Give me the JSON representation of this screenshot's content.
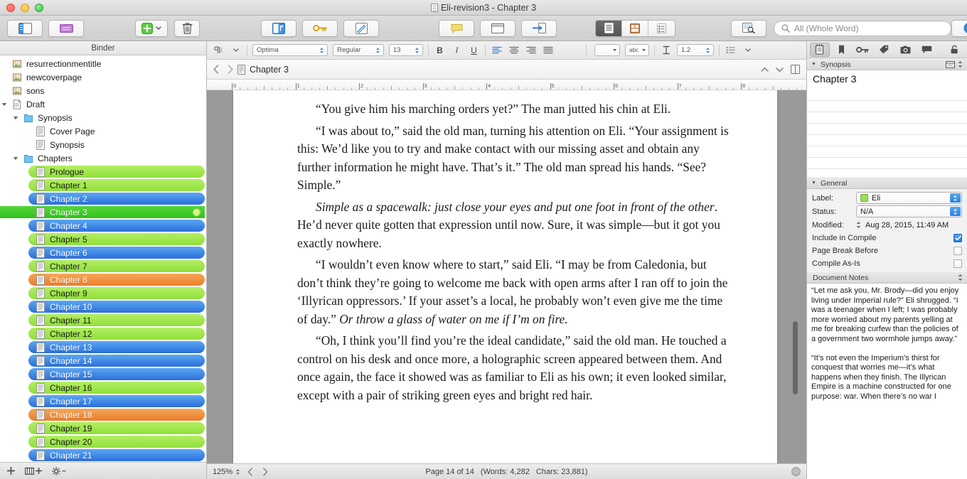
{
  "window": {
    "title": "Eli-revision3 - Chapter 3"
  },
  "toolbar": {
    "binder_label": "binder-toggle",
    "collections_label": "collections-toggle",
    "add_label": "add-new",
    "trash_label": "move-to-trash",
    "compile_label": "compile",
    "keywords_label": "keywords",
    "compose_label": "compose-mode",
    "comment_label": "comment",
    "quickref_label": "quick-reference",
    "split_label": "split-editor",
    "view_document": "document-view",
    "view_corkboard": "corkboard-view",
    "view_outline": "outliner-view",
    "project_search_label": "project-search",
    "search_placeholder": "All (Whole Word)",
    "inspector_label": "toggle-inspector"
  },
  "format_bar": {
    "font": "Optima",
    "style": "Regular",
    "size": "13",
    "bold": "B",
    "italic": "I",
    "underline": "U",
    "line_spacing": "1.2"
  },
  "binder": {
    "header": "Binder",
    "items": [
      {
        "label": "resurrectionmentitle",
        "icon": "image-icon",
        "depth": 0,
        "tint": "none",
        "twisty": "",
        "selected": false
      },
      {
        "label": "newcoverpage",
        "icon": "image-icon",
        "depth": 0,
        "tint": "none",
        "twisty": "",
        "selected": false
      },
      {
        "label": "sons",
        "icon": "image-icon",
        "depth": 0,
        "tint": "none",
        "twisty": "",
        "selected": false
      },
      {
        "label": "Draft",
        "icon": "draft-icon",
        "depth": 0,
        "tint": "none",
        "twisty": "down",
        "selected": false
      },
      {
        "label": "Synopsis",
        "icon": "folder-icon",
        "depth": 1,
        "tint": "none",
        "twisty": "down",
        "selected": false
      },
      {
        "label": "Cover Page",
        "icon": "text-icon",
        "depth": 2,
        "tint": "none",
        "twisty": "",
        "selected": false
      },
      {
        "label": "Synopsis",
        "icon": "text-icon",
        "depth": 2,
        "tint": "none",
        "twisty": "",
        "selected": false
      },
      {
        "label": "Chapters",
        "icon": "folder-icon",
        "depth": 1,
        "tint": "none",
        "twisty": "down",
        "selected": false
      },
      {
        "label": "Prologue",
        "icon": "text-icon",
        "depth": 2,
        "tint": "green",
        "twisty": "",
        "selected": false
      },
      {
        "label": "Chapter 1",
        "icon": "text-icon",
        "depth": 2,
        "tint": "green",
        "twisty": "",
        "selected": false
      },
      {
        "label": "Chapter 2",
        "icon": "text-icon",
        "depth": 2,
        "tint": "blue",
        "twisty": "",
        "selected": false
      },
      {
        "label": "Chapter 3",
        "icon": "text-icon",
        "depth": 2,
        "tint": "select",
        "twisty": "",
        "selected": true
      },
      {
        "label": "Chapter 4",
        "icon": "text-icon",
        "depth": 2,
        "tint": "blue",
        "twisty": "",
        "selected": false
      },
      {
        "label": "Chapter 5",
        "icon": "text-icon",
        "depth": 2,
        "tint": "green",
        "twisty": "",
        "selected": false
      },
      {
        "label": "Chapter 6",
        "icon": "text-icon",
        "depth": 2,
        "tint": "blue",
        "twisty": "",
        "selected": false
      },
      {
        "label": "Chapter 7",
        "icon": "text-icon",
        "depth": 2,
        "tint": "green",
        "twisty": "",
        "selected": false
      },
      {
        "label": "Chapter 8",
        "icon": "text-icon",
        "depth": 2,
        "tint": "orange",
        "twisty": "",
        "selected": false
      },
      {
        "label": "Chapter 9",
        "icon": "text-icon",
        "depth": 2,
        "tint": "green",
        "twisty": "",
        "selected": false
      },
      {
        "label": "Chapter 10",
        "icon": "text-icon",
        "depth": 2,
        "tint": "blue",
        "twisty": "",
        "selected": false
      },
      {
        "label": "Chapter 11",
        "icon": "text-icon",
        "depth": 2,
        "tint": "green",
        "twisty": "",
        "selected": false
      },
      {
        "label": "Chapter 12",
        "icon": "text-icon",
        "depth": 2,
        "tint": "green",
        "twisty": "",
        "selected": false
      },
      {
        "label": "Chapter 13",
        "icon": "text-icon",
        "depth": 2,
        "tint": "blue",
        "twisty": "",
        "selected": false
      },
      {
        "label": "Chapter 14",
        "icon": "text-icon",
        "depth": 2,
        "tint": "blue",
        "twisty": "",
        "selected": false
      },
      {
        "label": "Chapter 15",
        "icon": "text-icon",
        "depth": 2,
        "tint": "blue",
        "twisty": "",
        "selected": false
      },
      {
        "label": "Chapter 16",
        "icon": "text-icon",
        "depth": 2,
        "tint": "green",
        "twisty": "",
        "selected": false
      },
      {
        "label": "Chapter 17",
        "icon": "text-icon",
        "depth": 2,
        "tint": "blue",
        "twisty": "",
        "selected": false
      },
      {
        "label": "Chapter 18",
        "icon": "text-icon",
        "depth": 2,
        "tint": "orange",
        "twisty": "",
        "selected": false
      },
      {
        "label": "Chapter 19",
        "icon": "text-icon",
        "depth": 2,
        "tint": "green",
        "twisty": "",
        "selected": false
      },
      {
        "label": "Chapter 20",
        "icon": "text-icon",
        "depth": 2,
        "tint": "green",
        "twisty": "",
        "selected": false
      },
      {
        "label": "Chapter 21",
        "icon": "text-icon",
        "depth": 2,
        "tint": "blue",
        "twisty": "",
        "selected": false
      }
    ],
    "footer": {
      "add": "add-item",
      "add_folder": "add-folder",
      "settings": "binder-options"
    }
  },
  "editor": {
    "title": "Chapter 3",
    "back": "back",
    "forward": "forward",
    "ruler_numbers": [
      "0",
      "1",
      "2",
      "3",
      "4",
      "5",
      "6",
      "7",
      "8"
    ],
    "paragraphs": [
      {
        "runs": [
          {
            "text": "“You give him his marching orders yet?” The man jutted his chin at Eli.",
            "italic": false
          }
        ]
      },
      {
        "runs": [
          {
            "text": "“I was about to,” said the old man, turning his attention on Eli. “Your assignment is this: We’d like you to try and make contact with our missing asset and obtain any further information he might have. That’s it.” The old man spread his hands. “See? Simple.”",
            "italic": false
          }
        ]
      },
      {
        "runs": [
          {
            "text": "Simple as a spacewalk: just close your eyes and put one foot in front of the other",
            "italic": true
          },
          {
            "text": ". He’d never quite gotten that expression until now. Sure, it was simple—but it got you exactly nowhere.",
            "italic": false
          }
        ]
      },
      {
        "runs": [
          {
            "text": "“I wouldn’t even know where to start,” said Eli. “I may be from Caledonia, but don’t think they’re going to welcome me back with open arms after I ran off to join the ‘Illyrican oppressors.’ If your asset’s a local, he probably won’t even give me the time of day.” ",
            "italic": false
          },
          {
            "text": "Or throw a glass of water on me if I’m on fire.",
            "italic": true
          }
        ]
      },
      {
        "runs": [
          {
            "text": "“Oh, I think you’ll find you’re the ideal candidate,” said the old man. He touched a control on his desk and once more, a holographic screen appeared between them. And once again, the face it showed was as familiar to Eli as his own; it even looked similar, except with a pair of striking green eyes and bright red hair.",
            "italic": false
          }
        ]
      }
    ]
  },
  "status_bar": {
    "zoom": "125%",
    "prev_page": "previous-page",
    "next_page": "next-page",
    "page_info": "Page 14 of 14",
    "words": "(Words: 4,282",
    "chars": "Chars: 23,881)"
  },
  "inspector": {
    "tabs": [
      {
        "name": "notes-tab",
        "on": true
      },
      {
        "name": "bookmarks-tab",
        "on": false
      },
      {
        "name": "metadata-tab",
        "on": false
      },
      {
        "name": "keywords-tab",
        "on": false
      },
      {
        "name": "snapshots-tab",
        "on": false
      },
      {
        "name": "comments-tab",
        "on": false
      }
    ],
    "lock_icon": "lock-icon",
    "synopsis": {
      "header": "Synopsis",
      "title": "Chapter 3"
    },
    "general": {
      "header": "General",
      "label_label": "Label:",
      "label_value": "Eli",
      "label_color": "#9ade56",
      "status_label": "Status:",
      "status_value": "N/A",
      "modified_label": "Modified:",
      "modified_value": "Aug 28, 2015, 11:49 AM",
      "checkboxes": [
        {
          "label": "Include in Compile",
          "checked": true
        },
        {
          "label": "Page Break Before",
          "checked": false
        },
        {
          "label": "Compile As-Is",
          "checked": false
        }
      ]
    },
    "notes": {
      "header": "Document Notes",
      "paragraphs": [
        "“Let me ask you, Mr. Brody—did you enjoy living under Imperial rule?” Eli shrugged. “I was a teenager when I left; I was probably more worried about my parents yelling at me for breaking curfew than the policies of a government two wormhole jumps away.”",
        "“It’s not even the Imperium’s thirst for conquest that worries me—it’s what happens when they finish. The Illyrican Empire is a machine constructed for one purpose: war. When there’s no war I"
      ]
    }
  }
}
